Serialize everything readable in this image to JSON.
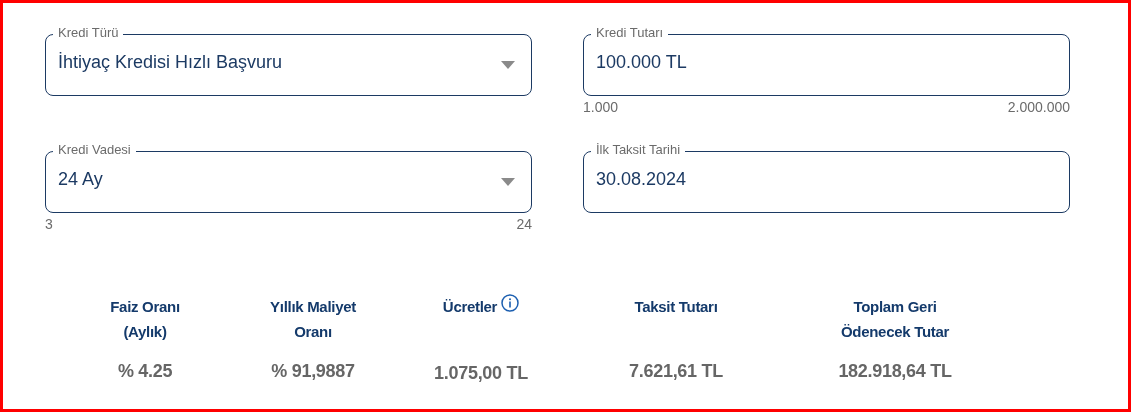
{
  "fields": [
    {
      "label": "Kredi Türü",
      "value": "İhtiyaç Kredisi Hızlı Başvuru",
      "kind": "select"
    },
    {
      "label": "Kredi Tutarı",
      "value": "100.000 TL",
      "kind": "text",
      "min": "1.000",
      "max": "2.000.000"
    },
    {
      "label": "Kredi Vadesi",
      "value": "24 Ay",
      "kind": "select",
      "min": "3",
      "max": "24"
    },
    {
      "label": "İlk Taksit Tarihi",
      "value": "30.08.2024",
      "kind": "text"
    }
  ],
  "summary": [
    {
      "label": "Faiz Oranı (Aylık)",
      "value": "% 4.25",
      "info": false
    },
    {
      "label": "Yıllık Maliyet Oranı",
      "value": "% 91,9887",
      "info": false
    },
    {
      "label": "Ücretler",
      "value": "1.075,00 TL",
      "info": true
    },
    {
      "label": "Taksit Tutarı",
      "value": "7.621,61 TL",
      "info": false
    },
    {
      "label": "Toplam Geri Ödenecek Tutar",
      "value": "182.918,64 TL",
      "info": false
    }
  ]
}
